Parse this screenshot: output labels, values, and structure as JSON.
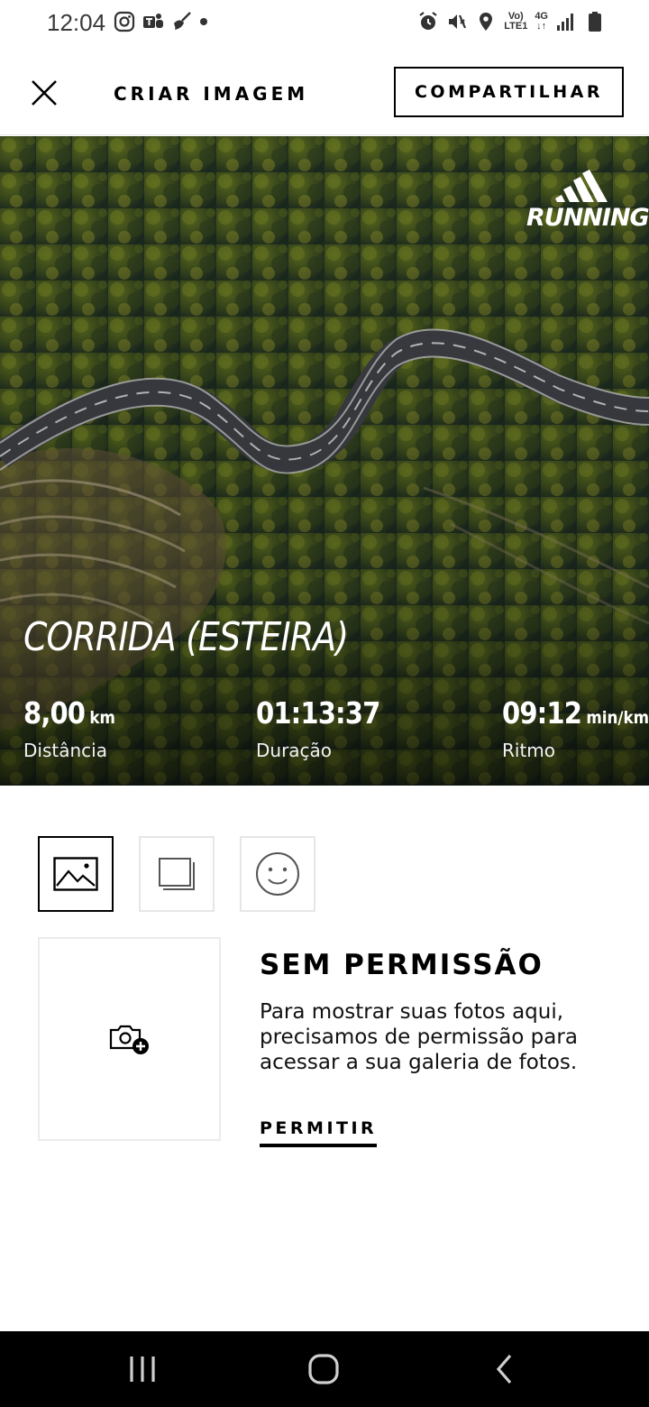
{
  "status_bar": {
    "time": "12:04",
    "lte_top": "Vo)",
    "lte_bottom": "LTE1",
    "network": "4G",
    "icons_left": [
      "instagram-icon",
      "teams-icon",
      "broom-icon",
      "dot-icon"
    ],
    "icons_right": [
      "alarm-icon",
      "mute-icon",
      "location-icon",
      "lte-icon",
      "network-4g-icon",
      "signal-icon",
      "battery-icon"
    ]
  },
  "header": {
    "title": "CRIAR IMAGEM",
    "share_label": "COMPARTILHAR"
  },
  "hero": {
    "brand_label": "RUNNING",
    "activity_title": "CORRIDA (ESTEIRA)",
    "stats": [
      {
        "value": "8,00",
        "unit": "km",
        "label": "Distância"
      },
      {
        "value": "01:13:37",
        "unit": "",
        "label": "Duração"
      },
      {
        "value": "09:12",
        "unit": "min/km",
        "label": "Ritmo"
      }
    ]
  },
  "tabs": [
    {
      "icon": "image-icon",
      "active": true
    },
    {
      "icon": "layers-icon",
      "active": false
    },
    {
      "icon": "smiley-icon",
      "active": false
    }
  ],
  "permission": {
    "title": "SEM PERMISSÃO",
    "text": "Para mostrar suas fotos aqui, precisamos de permissão para acessar a sua galeria de fotos.",
    "button": "PERMITIR"
  },
  "colors": {
    "accent": "#000000",
    "tab_border": "#e6e6e6"
  }
}
